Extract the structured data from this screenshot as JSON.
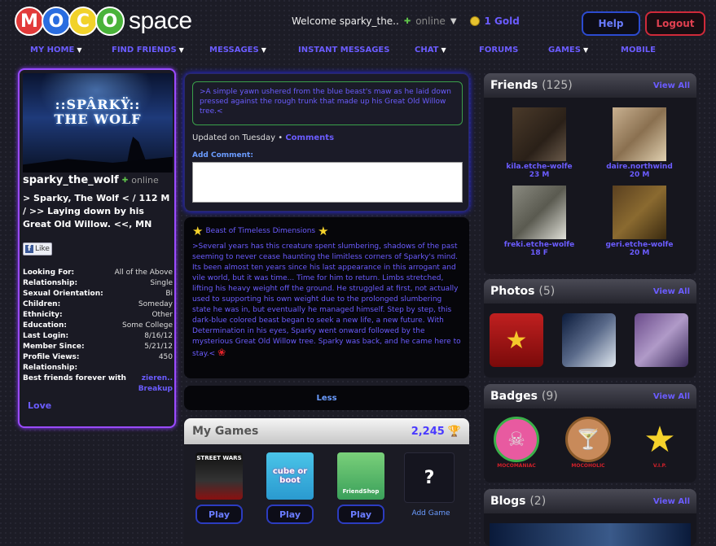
{
  "header": {
    "logo_letters": [
      "M",
      "O",
      "C",
      "O"
    ],
    "logo_colors": [
      "#e23a3a",
      "#2a6de0",
      "#f1d22a",
      "#4ab33a"
    ],
    "logo_word": "space",
    "welcome": "Welcome sparky_the..",
    "status": "online",
    "gold": "1 Gold",
    "help": "Help",
    "logout": "Logout"
  },
  "nav": {
    "items": [
      "MY HOME",
      "FIND FRIENDS",
      "MESSAGES",
      "INSTANT MESSAGES",
      "CHAT",
      "FORUMS",
      "GAMES",
      "MOBILE"
    ]
  },
  "profile": {
    "pic_title_line1": "::SPÂRKŸ::",
    "pic_title_line2": "THE WOLF",
    "username": "sparky_the_wolf",
    "status": "online",
    "status_text": "> Sparky, The Wolf < / 112 M / >> Laying down by his Great Old Willow. <<, MN",
    "like": "Like",
    "details": [
      {
        "k": "Looking For:",
        "v": "All of the Above"
      },
      {
        "k": "Relationship:",
        "v": "Single"
      },
      {
        "k": "Sexual Orientation:",
        "v": "Bi"
      },
      {
        "k": "Children:",
        "v": "Someday"
      },
      {
        "k": "Ethnicity:",
        "v": "Other"
      },
      {
        "k": "Education:",
        "v": "Some College"
      },
      {
        "k": "Last Login:",
        "v": "8/16/12"
      },
      {
        "k": "Member Since:",
        "v": "5/21/12"
      },
      {
        "k": "Profile Views:",
        "v": "450"
      },
      {
        "k": "Relationship:",
        "v": ""
      }
    ],
    "bff_label": "Best friends forever with",
    "bff_name": "zieren..",
    "breakup": "Breakup",
    "love": "Love"
  },
  "status_box": {
    "quote": ">A simple yawn ushered from the blue beast's maw as he laid down pressed against the rough trunk that made up his Great Old Willow tree.<",
    "updated": "Updated on Tuesday",
    "dot": "•",
    "comments": "Comments",
    "add_comment": "Add Comment:",
    "comment_value": ""
  },
  "about": {
    "title": "Beast of Timeless Dimensions",
    "body": ">Several years has this creature spent slumbering, shadows of the past seeming to never cease haunting the limitless corners of Sparky's mind. Its been almost ten years since his last appearance in this arrogant and vile world, but it was time... Time for him to return. Limbs stretched, lifting his heavy weight off the ground. He struggled at first, not actually used to supporting his own weight due to the prolonged slumbering state he was in, but eventually he managed himself. Step by step, this dark-blue colored beast began to seek a new life, a new future. With Determination in his eyes, Sparky went onward followed by the mysterious Great Old Willow tree. Sparky was back, and he came here to stay.<",
    "less": "Less"
  },
  "games": {
    "title": "My Games",
    "count": "2,245",
    "play": "Play",
    "add_game": "Add Game",
    "question": "?",
    "thumbs": [
      "STREET WARS",
      "cube or boot",
      "FriendShop"
    ]
  },
  "friends": {
    "title": "Friends",
    "count": "(125)",
    "view_all": "View All",
    "items": [
      {
        "name": "kila.etche-wolfe",
        "info": "23 M"
      },
      {
        "name": "daire.northwind",
        "info": "20 M"
      },
      {
        "name": "freki.etche-wolfe",
        "info": "18 F"
      },
      {
        "name": "geri.etche-wolfe",
        "info": "20 M"
      }
    ]
  },
  "photos": {
    "title": "Photos",
    "count": "(5)",
    "view_all": "View All"
  },
  "badges": {
    "title": "Badges",
    "count": "(9)",
    "view_all": "View All",
    "items": [
      "MOCOMANIAC",
      "MOCOHOLIC",
      "V.I.P."
    ]
  },
  "blogs": {
    "title": "Blogs",
    "count": "(2)",
    "view_all": "View All"
  }
}
